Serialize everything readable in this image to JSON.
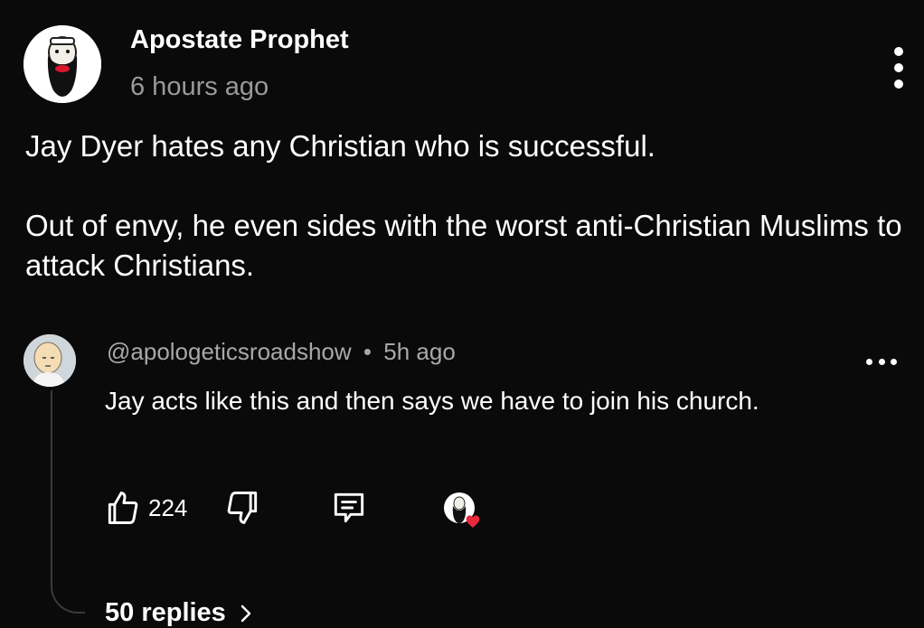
{
  "post": {
    "author": "Apostate Prophet",
    "time": "6 hours ago",
    "paragraphs": [
      "Jay Dyer hates any Christian who is successful.",
      "Out of envy, he even sides with the worst anti-Christian Muslims to attack Christians."
    ]
  },
  "reply": {
    "handle": "@apologeticsroadshow",
    "separator": "•",
    "time": "5h ago",
    "text": "Jay acts like this and then says we have to join his church."
  },
  "actions": {
    "like_count": "224"
  },
  "replies_link": {
    "label": "50 replies"
  },
  "icons": {
    "post_menu": "vertical-dots-icon",
    "reply_menu": "horizontal-dots-icon",
    "like": "thumbs-up-icon",
    "dislike": "thumbs-down-icon",
    "reply": "comment-bubble-icon",
    "creator_heart": "creator-heart-badge",
    "chevron": "chevron-right-icon"
  },
  "colors": {
    "background": "#0a0a0a",
    "text": "#ffffff",
    "secondary_text": "#9a9a9a",
    "heart": "#e8283c"
  }
}
